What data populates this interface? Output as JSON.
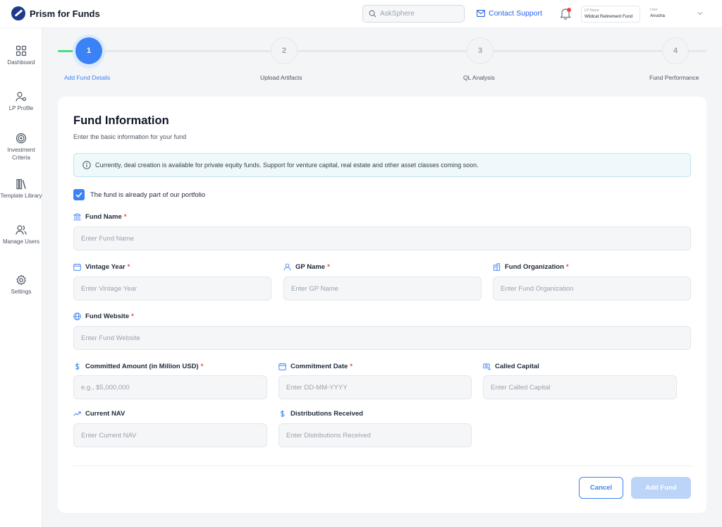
{
  "app": {
    "name": "Prism for Funds",
    "logo_icon": "prism-logo-icon"
  },
  "header": {
    "search_placeholder": "AskSphere",
    "contact_support": "Contact Support",
    "lp_selector": {
      "label": "LP Name",
      "value": "Wildcat Retirement Fund"
    },
    "user_selector": {
      "label": "User",
      "value": "Anusha"
    }
  },
  "sidebar": {
    "items": [
      {
        "label": "Dashboard",
        "icon": "grid-icon"
      },
      {
        "label": "LP Profile",
        "icon": "user-settings-icon"
      },
      {
        "label": "Investment Criteria",
        "icon": "target-icon"
      },
      {
        "label": "Template Library",
        "icon": "library-icon"
      },
      {
        "label": "Manage Users",
        "icon": "users-icon"
      },
      {
        "label": "Settings",
        "icon": "gear-icon"
      }
    ]
  },
  "stepper": {
    "current_step": 1,
    "steps": [
      {
        "number": "1",
        "label": "Add Fund Details"
      },
      {
        "number": "2",
        "label": "Upload Artifacts"
      },
      {
        "number": "3",
        "label": "QL Analysis"
      },
      {
        "number": "4",
        "label": "Fund Performance"
      }
    ]
  },
  "form": {
    "title": "Fund Information",
    "subtitle": "Enter the basic information for your fund",
    "info_banner": "Currently, deal creation is available for  private equity funds. Support for venture capital, real estate and other asset classes coming soon.",
    "portfolio_checkbox": {
      "label": "The fund is already part of our portfolio",
      "checked": true
    },
    "required_marker": "*",
    "fields": {
      "fund_name": {
        "label": "Fund Name",
        "placeholder": "Enter Fund Name",
        "value": ""
      },
      "vintage_year": {
        "label": "Vintage Year",
        "placeholder": "Enter Vintage Year",
        "value": ""
      },
      "gp_name": {
        "label": "GP Name",
        "placeholder": "Enter GP Name",
        "value": ""
      },
      "fund_organization": {
        "label": "Fund Organization",
        "placeholder": "Enter Fund Organization",
        "value": ""
      },
      "fund_website": {
        "label": "Fund Website",
        "placeholder": "Enter Fund Website",
        "value": ""
      },
      "committed_amount": {
        "label": "Committed Amount (in Million USD)",
        "placeholder": "e.g., $5,000,000",
        "value": ""
      },
      "commitment_date": {
        "label": "Commitment Date",
        "placeholder": "Enter DD-MM-YYYY",
        "value": ""
      },
      "called_capital": {
        "label": "Called Capital",
        "placeholder": "Enter Called Capital",
        "value": ""
      },
      "current_nav": {
        "label": "Current NAV",
        "placeholder": "Enter Current NAV",
        "value": ""
      },
      "distributions_received": {
        "label": "Distributions Received",
        "placeholder": "Enter Distributions Received",
        "value": ""
      }
    },
    "actions": {
      "cancel": "Cancel",
      "add": "Add Fund"
    }
  },
  "colors": {
    "primary": "#3b82f6",
    "progress": "#4ade80",
    "required": "#ef4444",
    "notification": "#ef4444",
    "disabled_button": "#bcd4f7"
  }
}
